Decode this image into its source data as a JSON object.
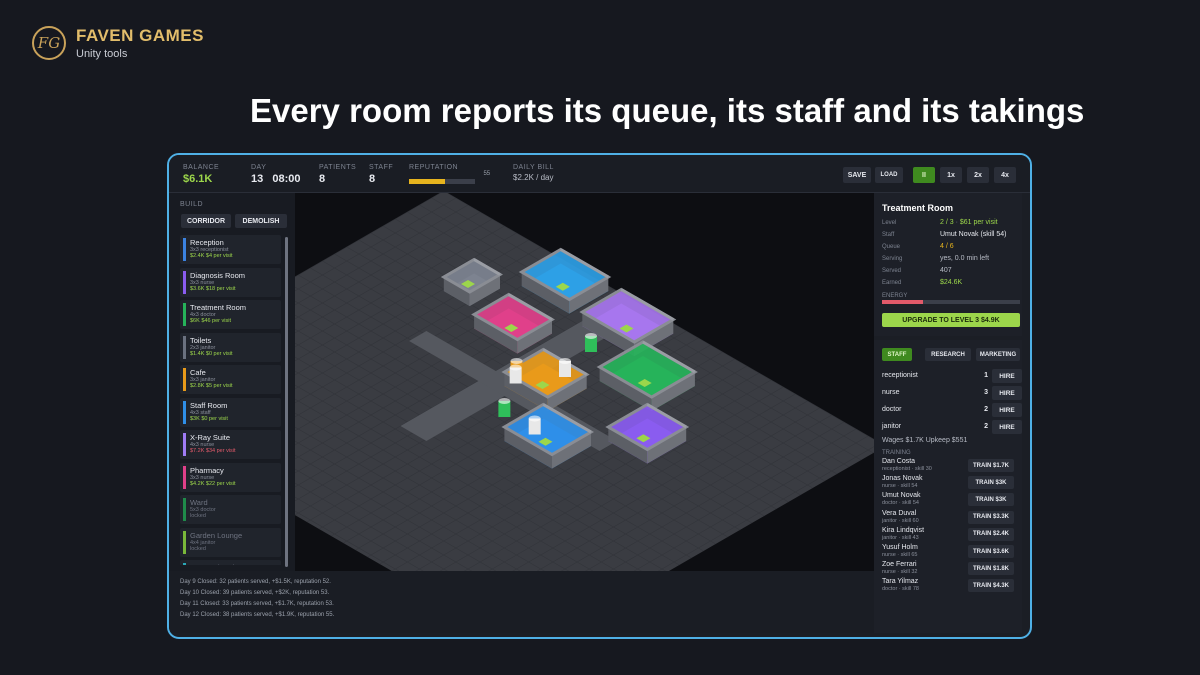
{
  "brand": {
    "logo": "FG",
    "name": "FAVEN GAMES",
    "sub": "Unity tools"
  },
  "headline": "Every room reports its queue, its staff and its takings",
  "topbar": {
    "balance": {
      "label": "BALANCE",
      "value": "$6.1K"
    },
    "day": {
      "label": "DAY",
      "value": "13   08:00"
    },
    "patients": {
      "label": "PATIENTS",
      "value": "8"
    },
    "staff": {
      "label": "STAFF",
      "value": "8"
    },
    "reputation": {
      "label": "REPUTATION",
      "value": "55",
      "fraction": 0.55
    },
    "daily_bill": {
      "label": "DAILY BILL",
      "value": "$2.2K / day"
    },
    "save": "SAVE",
    "load": "LOAD",
    "pause": "II",
    "speed1": "1x",
    "speed2": "2x",
    "speed4": "4x"
  },
  "sidebar": {
    "build_label": "BUILD",
    "corridor": "CORRIDOR",
    "demolish": "DEMOLISH",
    "rooms": [
      {
        "name": "Reception",
        "sub": "3x3   receptionist",
        "cost": "$2.4K",
        "per": "$4 per visit",
        "color": "#3b82e0",
        "locked": false,
        "neg": false
      },
      {
        "name": "Diagnosis Room",
        "sub": "3x3   nurse",
        "cost": "$3.6K",
        "per": "$18 per visit",
        "color": "#8a5cf0",
        "locked": false,
        "neg": false
      },
      {
        "name": "Treatment Room",
        "sub": "4x3   doctor",
        "cost": "$6K",
        "per": "$46 per visit",
        "color": "#26b35a",
        "locked": false,
        "neg": false
      },
      {
        "name": "Toilets",
        "sub": "2x3   janitor",
        "cost": "$1.4K",
        "per": "$0 per visit",
        "color": "#6b7280",
        "locked": false,
        "neg": false
      },
      {
        "name": "Cafe",
        "sub": "3x3   janitor",
        "cost": "$2.8K",
        "per": "$5 per visit",
        "color": "#e89a1a",
        "locked": false,
        "neg": false
      },
      {
        "name": "Staff Room",
        "sub": "4x3   staff",
        "cost": "$3K",
        "per": "$0 per visit",
        "color": "#2f8fe8",
        "locked": false,
        "neg": false
      },
      {
        "name": "X-Ray Suite",
        "sub": "4x3   nurse",
        "cost": "$7.2K",
        "per": "$34 per visit",
        "color": "#a07cf5",
        "locked": false,
        "neg": true
      },
      {
        "name": "Pharmacy",
        "sub": "3x3   nurse",
        "cost": "$4.2K",
        "per": "$22 per visit",
        "color": "#e0408a",
        "locked": false,
        "neg": false
      },
      {
        "name": "Ward",
        "sub": "5x3   doctor",
        "cost": "locked",
        "per": "",
        "color": "#1f8a4a",
        "locked": true,
        "neg": false
      },
      {
        "name": "Garden Lounge",
        "sub": "4x4   janitor",
        "cost": "locked",
        "per": "",
        "color": "#7ab83a",
        "locked": true,
        "neg": false
      },
      {
        "name": "Research Lab",
        "sub": "",
        "cost": "",
        "per": "",
        "color": "#2aa8b8",
        "locked": true,
        "neg": false
      }
    ]
  },
  "log": [
    "Day 9   Closed: 32 patients served, +$1.5K, reputation 52.",
    "Day 10   Closed: 39 patients served, +$2K, reputation 53.",
    "Day 11   Closed: 33 patients served, +$1.7K, reputation 53.",
    "Day 12   Closed: 38 patients served, +$1.9K, reputation 55."
  ],
  "inspector": {
    "title": "Treatment Room",
    "level_label": "Level",
    "level": "2 / 3",
    "level_dot": "·",
    "level_per": "$61 per visit",
    "staff_label": "Staff",
    "staff": "Umut Novak  (skill 54)",
    "queue_label": "Queue",
    "queue": "4 / 6",
    "serving_label": "Serving",
    "serving": "yes, 0.0 min left",
    "served_label": "Served",
    "served": "407",
    "earned_label": "Earned",
    "earned": "$24.6K",
    "energy_label": "ENERGY",
    "energy_fraction": 0.3,
    "upgrade": "UPGRADE TO LEVEL 3   $4.9K"
  },
  "staff_panel": {
    "tabs": [
      "STAFF",
      "RESEARCH",
      "MARKETING"
    ],
    "roles": [
      {
        "role": "receptionist",
        "count": "1",
        "hire": "HIRE"
      },
      {
        "role": "nurse",
        "count": "3",
        "hire": "HIRE"
      },
      {
        "role": "doctor",
        "count": "2",
        "hire": "HIRE"
      },
      {
        "role": "janitor",
        "count": "2",
        "hire": "HIRE"
      }
    ],
    "wages": "Wages $1.7K   Upkeep $551",
    "training_label": "TRAINING",
    "trainees": [
      {
        "name": "Dan Costa",
        "sub": "receptionist  ·  skill 30",
        "btn": "TRAIN $1.7K"
      },
      {
        "name": "Jonas Novak",
        "sub": "nurse  ·  skill 54",
        "btn": "TRAIN $3K"
      },
      {
        "name": "Umut Novak",
        "sub": "doctor  ·  skill 54",
        "btn": "TRAIN $3K"
      },
      {
        "name": "Vera Duval",
        "sub": "janitor  ·  skill 60",
        "btn": "TRAIN $3.3K"
      },
      {
        "name": "Kira Lindqvist",
        "sub": "janitor  ·  skill 43",
        "btn": "TRAIN $2.4K"
      },
      {
        "name": "Yusuf Holm",
        "sub": "nurse  ·  skill 65",
        "btn": "TRAIN $3.6K"
      },
      {
        "name": "Zoe Ferrari",
        "sub": "nurse  ·  skill 32",
        "btn": "TRAIN $1.8K"
      },
      {
        "name": "Tara Yilmaz",
        "sub": "doctor  ·  skill 78",
        "btn": "TRAIN $4.3K"
      }
    ]
  },
  "map_rooms": [
    {
      "color": "#2ea0e6"
    },
    {
      "color": "#a776ee"
    },
    {
      "color": "#7d8390"
    },
    {
      "color": "#e0408a"
    },
    {
      "color": "#26b35a"
    },
    {
      "color": "#e89a1a"
    },
    {
      "color": "#8a5cf0"
    },
    {
      "color": "#2f8fe8"
    }
  ]
}
